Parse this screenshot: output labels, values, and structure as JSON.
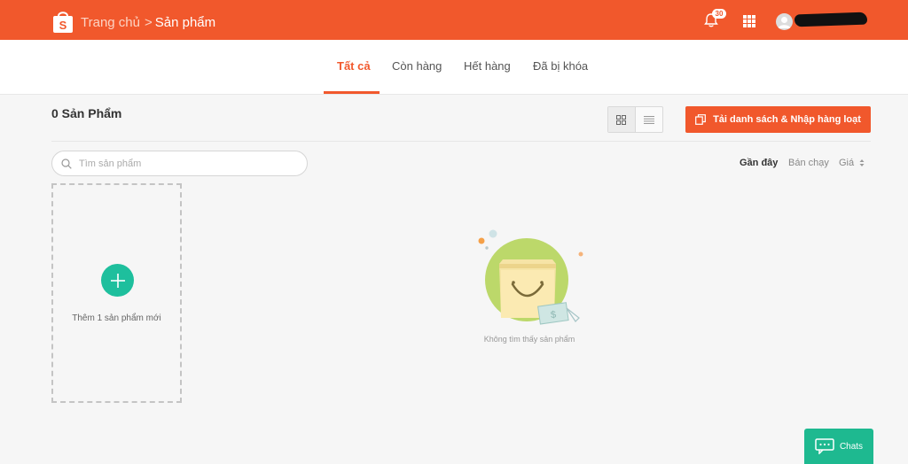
{
  "header": {
    "breadcrumb_home": "Trang chủ",
    "breadcrumb_separator": ">",
    "breadcrumb_current": "Sản phẩm",
    "notification_count": "30",
    "brand_color": "#f1582c"
  },
  "tabs": [
    {
      "label": "Tất cả",
      "active": true
    },
    {
      "label": "Còn hàng",
      "active": false
    },
    {
      "label": "Hết hàng",
      "active": false
    },
    {
      "label": "Đã bị khóa",
      "active": false
    }
  ],
  "toolbar": {
    "product_count": "0 Sản Phẩm",
    "upload_button": "Tải danh sách & Nhập hàng loạt",
    "view_mode": "grid"
  },
  "search": {
    "placeholder": "Tìm sản phẩm"
  },
  "sort": {
    "options": [
      "Gần đây",
      "Bán chạy",
      "Giá"
    ],
    "active": "Gần đây"
  },
  "add_card": {
    "label": "Thêm 1 sản phẩm mới"
  },
  "empty_state": {
    "message": "Không tìm thấy sản phẩm"
  },
  "chat": {
    "label": "Chats",
    "color": "#1eb990"
  }
}
